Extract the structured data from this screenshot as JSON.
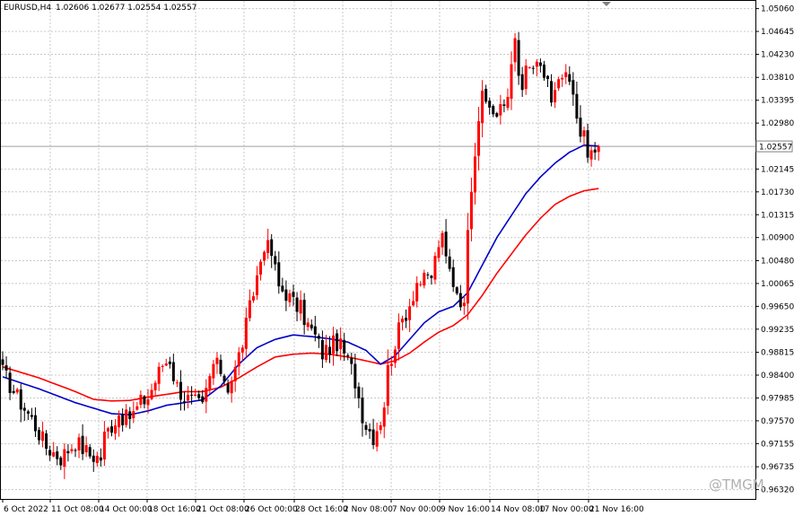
{
  "header": {
    "symbol_label": "EURUSD,H4",
    "ohlc_label": "1.02606 1.02677 1.02554 1.02557"
  },
  "watermark": "@TMGM",
  "colors": {
    "up_candle": "#ff0000",
    "down_candle": "#000000",
    "ma_fast": "#0000c8",
    "ma_slow": "#ff0000",
    "grid": "#c8c8c8",
    "price_line": "#a0a0a0"
  },
  "chart_data": {
    "type": "candlestick",
    "symbol": "EURUSD",
    "timeframe": "H4",
    "ylim": [
      0.9615,
      1.052
    ],
    "y_ticks": [
      "1.05060",
      "1.04645",
      "1.04230",
      "1.03810",
      "1.03395",
      "1.02980",
      "1.02145",
      "1.01730",
      "1.01315",
      "1.00900",
      "1.00480",
      "1.00065",
      "0.99650",
      "0.99235",
      "0.98815",
      "0.98400",
      "0.97985",
      "0.97570",
      "0.97155",
      "0.96735",
      "0.96320"
    ],
    "current_price": "1.02557",
    "x_labels": [
      "6 Oct 2022",
      "11 Oct 08:00",
      "14 Oct 00:00",
      "18 Oct 16:00",
      "21 Oct 08:00",
      "26 Oct 00:00",
      "28 Oct 16:00",
      "2 Nov 08:00",
      "7 Nov 00:00",
      "9 Nov 16:00",
      "14 Nov 08:00",
      "17 Nov 00:00",
      "21 Nov 16:00"
    ],
    "grid": true,
    "close_path": [
      [
        0,
        0.9845
      ],
      [
        4,
        0.98
      ],
      [
        8,
        0.976
      ],
      [
        12,
        0.971
      ],
      [
        16,
        0.969
      ],
      [
        20,
        0.972
      ],
      [
        24,
        0.9695
      ],
      [
        27,
        0.969
      ],
      [
        28,
        0.973
      ],
      [
        30,
        0.975
      ],
      [
        32,
        0.977
      ],
      [
        34,
        0.976
      ],
      [
        36,
        0.977
      ],
      [
        38,
        0.979
      ],
      [
        40,
        0.98
      ],
      [
        42,
        0.983
      ],
      [
        44,
        0.986
      ],
      [
        46,
        0.987
      ],
      [
        47,
        0.984
      ],
      [
        48,
        0.982
      ],
      [
        50,
        0.98
      ],
      [
        53,
        0.979
      ],
      [
        55,
        0.978
      ],
      [
        56,
        0.981
      ],
      [
        58,
        0.986
      ],
      [
        60,
        0.985
      ],
      [
        62,
        0.982
      ],
      [
        64,
        0.985
      ],
      [
        66,
        0.99
      ],
      [
        68,
        0.996
      ],
      [
        70,
        1.002
      ],
      [
        72,
        1.008
      ],
      [
        74,
        1.006
      ],
      [
        76,
        1.0
      ],
      [
        78,
        0.999
      ],
      [
        80,
        0.997
      ],
      [
        82,
        0.996
      ],
      [
        84,
        0.993
      ],
      [
        86,
        0.991
      ],
      [
        88,
        0.988
      ],
      [
        90,
        0.989
      ],
      [
        92,
        0.99
      ],
      [
        94,
        0.988
      ],
      [
        96,
        0.985
      ],
      [
        97,
        0.983
      ],
      [
        98,
        0.98
      ],
      [
        99,
        0.977
      ],
      [
        100,
        0.975
      ],
      [
        101,
        0.974
      ],
      [
        102,
        0.973
      ],
      [
        104,
        0.976
      ],
      [
        105,
        0.979
      ],
      [
        106,
        0.985
      ],
      [
        108,
        0.99
      ],
      [
        110,
        0.994
      ],
      [
        112,
        0.997
      ],
      [
        114,
        1.001
      ],
      [
        116,
        1.001
      ],
      [
        118,
        1.002
      ],
      [
        120,
        1.008
      ],
      [
        121,
        1.0085
      ],
      [
        122,
        1.005
      ],
      [
        124,
        1.001
      ],
      [
        126,
        0.998
      ],
      [
        127,
        0.996
      ],
      [
        128,
        1.012
      ],
      [
        129,
        1.019
      ],
      [
        130,
        1.025
      ],
      [
        131,
        1.031
      ],
      [
        132,
        1.034
      ],
      [
        134,
        1.033
      ],
      [
        136,
        1.031
      ],
      [
        138,
        1.033
      ],
      [
        139,
        1.035
      ],
      [
        140,
        1.042
      ],
      [
        141,
        1.044
      ],
      [
        142,
        1.038
      ],
      [
        143,
        1.036
      ],
      [
        144,
        1.039
      ],
      [
        146,
        1.04
      ],
      [
        148,
        1.039
      ],
      [
        150,
        1.038
      ],
      [
        151,
        1.033
      ],
      [
        152,
        1.035
      ],
      [
        154,
        1.038
      ],
      [
        156,
        1.037
      ],
      [
        158,
        1.031
      ],
      [
        160,
        1.027
      ],
      [
        161,
        1.0235
      ],
      [
        162,
        1.0245
      ],
      [
        163,
        1.025
      ],
      [
        164,
        1.0256
      ]
    ],
    "ma_fast": [
      [
        0,
        0.9837
      ],
      [
        10,
        0.9815
      ],
      [
        20,
        0.979
      ],
      [
        30,
        0.977
      ],
      [
        35,
        0.9768
      ],
      [
        40,
        0.9775
      ],
      [
        45,
        0.9785
      ],
      [
        50,
        0.979
      ],
      [
        55,
        0.9795
      ],
      [
        60,
        0.982
      ],
      [
        65,
        0.986
      ],
      [
        70,
        0.989
      ],
      [
        75,
        0.9905
      ],
      [
        80,
        0.9913
      ],
      [
        85,
        0.991
      ],
      [
        90,
        0.9906
      ],
      [
        95,
        0.99
      ],
      [
        100,
        0.9885
      ],
      [
        104,
        0.986
      ],
      [
        108,
        0.9875
      ],
      [
        112,
        0.9905
      ],
      [
        116,
        0.9935
      ],
      [
        120,
        0.9955
      ],
      [
        124,
        0.9965
      ],
      [
        128,
        0.999
      ],
      [
        132,
        1.004
      ],
      [
        136,
        1.009
      ],
      [
        140,
        1.013
      ],
      [
        144,
        1.017
      ],
      [
        148,
        1.02
      ],
      [
        152,
        1.0225
      ],
      [
        156,
        1.0245
      ],
      [
        160,
        1.0258
      ],
      [
        164,
        1.0256
      ]
    ],
    "ma_slow": [
      [
        0,
        0.9855
      ],
      [
        10,
        0.9835
      ],
      [
        20,
        0.981
      ],
      [
        25,
        0.9796
      ],
      [
        30,
        0.9793
      ],
      [
        35,
        0.9794
      ],
      [
        40,
        0.98
      ],
      [
        45,
        0.9805
      ],
      [
        50,
        0.981
      ],
      [
        55,
        0.981
      ],
      [
        60,
        0.9818
      ],
      [
        65,
        0.9835
      ],
      [
        70,
        0.9855
      ],
      [
        75,
        0.9873
      ],
      [
        80,
        0.9878
      ],
      [
        85,
        0.988
      ],
      [
        90,
        0.9878
      ],
      [
        95,
        0.9873
      ],
      [
        100,
        0.9866
      ],
      [
        104,
        0.986
      ],
      [
        108,
        0.9866
      ],
      [
        112,
        0.988
      ],
      [
        116,
        0.99
      ],
      [
        120,
        0.9918
      ],
      [
        124,
        0.993
      ],
      [
        128,
        0.995
      ],
      [
        132,
        0.9985
      ],
      [
        136,
        1.0025
      ],
      [
        140,
        1.006
      ],
      [
        144,
        1.0095
      ],
      [
        148,
        1.0125
      ],
      [
        152,
        1.015
      ],
      [
        156,
        1.0165
      ],
      [
        160,
        1.0175
      ],
      [
        164,
        1.0179
      ]
    ]
  }
}
